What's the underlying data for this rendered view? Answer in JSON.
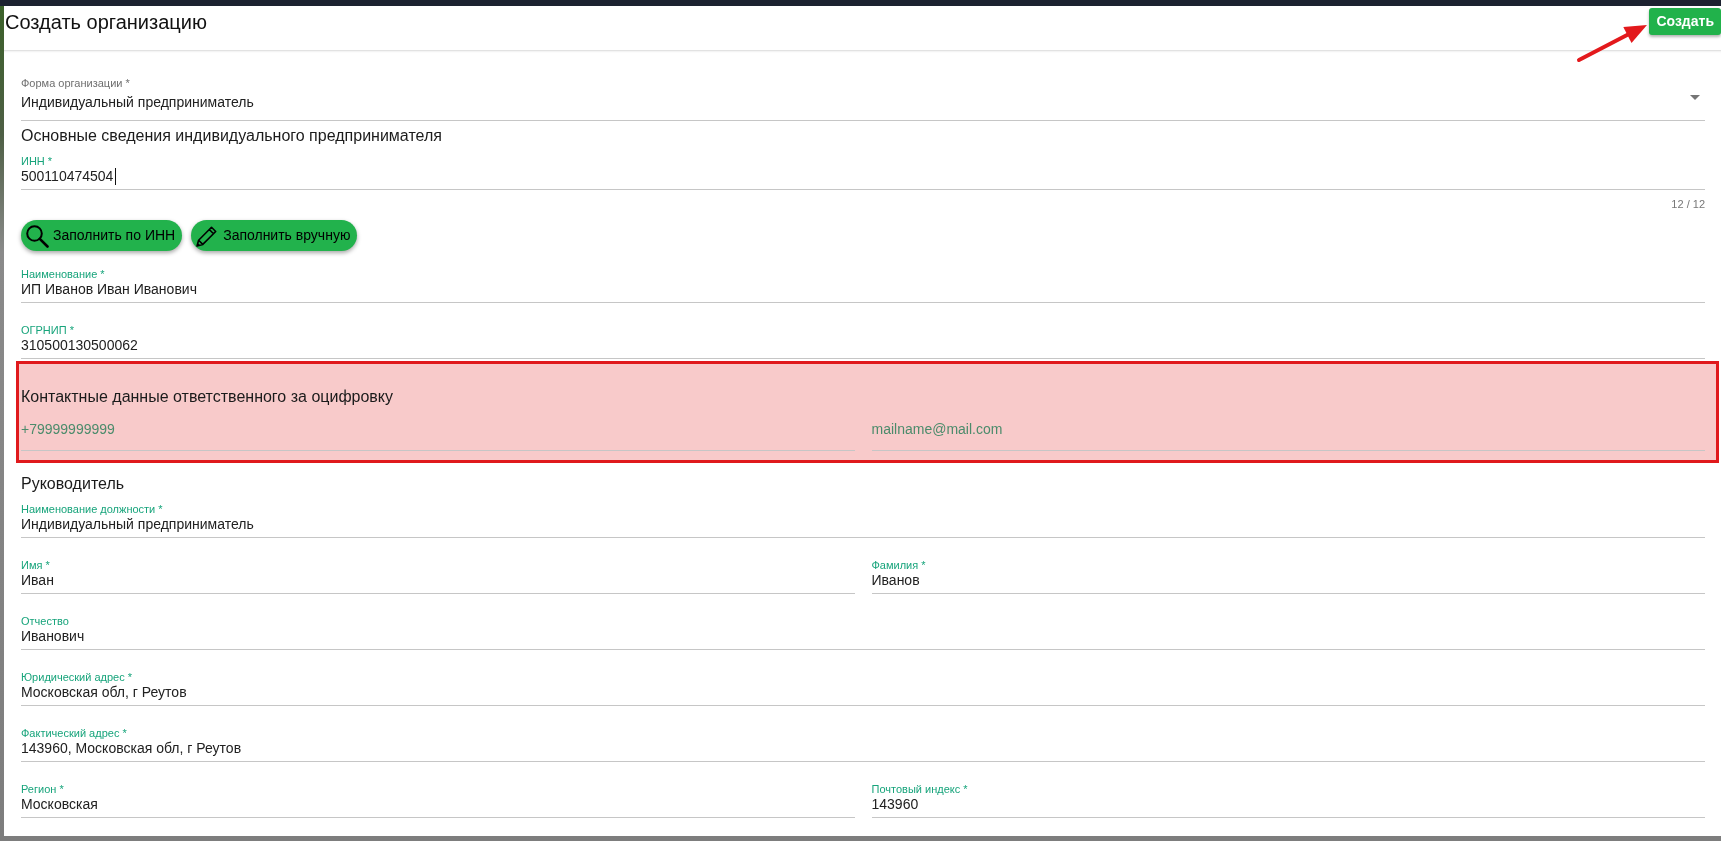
{
  "dialog": {
    "title": "Создать организацию",
    "create_button": {
      "label": "Создать",
      "pointed_at": true
    }
  },
  "organization_form": {
    "label": "Форма организации *",
    "value": "Индивидуальный предприниматель"
  },
  "sections": [
    {
      "title": "Основные сведения индивидуального предпринимателя",
      "highlighted": false,
      "rows": [
        {
          "kind": "fields",
          "fields": [
            {
              "label": "ИНН *",
              "value": "500110474504",
              "focused": true,
              "counter": "12 / 12"
            }
          ]
        },
        {
          "kind": "buttons",
          "buttons": [
            {
              "kind": "lookup",
              "label": "Заполнить по ИНН"
            },
            {
              "kind": "manual",
              "label": "Заполнить вручную"
            }
          ]
        },
        {
          "kind": "fields",
          "fields": [
            {
              "label": "Наименование *",
              "value": "ИП Иванов Иван Иванович",
              "focused": false
            }
          ]
        },
        {
          "kind": "fields",
          "fields": [
            {
              "label": "ОГРНИП *",
              "value": "310500130500062",
              "focused": false
            }
          ]
        }
      ]
    },
    {
      "title": "Контактные данные ответственного за оцифровку",
      "highlighted": true,
      "rows": [
        {
          "kind": "fields",
          "fields": [
            {
              "placeholder": "+79999999999",
              "focused": false
            },
            {
              "placeholder": "mailname@mail.com",
              "focused": false
            }
          ]
        }
      ]
    },
    {
      "title": "Руководитель",
      "highlighted": false,
      "rows": [
        {
          "kind": "fields",
          "fields": [
            {
              "label": "Наименование должности *",
              "value": "Индивидуальный предприниматель",
              "focused": false
            }
          ]
        },
        {
          "kind": "fields",
          "fields": [
            {
              "label": "Имя *",
              "value": "Иван",
              "focused": false
            },
            {
              "label": "Фамилия *",
              "value": "Иванов",
              "focused": false
            }
          ]
        },
        {
          "kind": "fields",
          "fields": [
            {
              "label": "Отчество",
              "value": "Иванович",
              "focused": false
            }
          ]
        },
        {
          "kind": "fields",
          "fields": [
            {
              "label": "Юридический адрес *",
              "value": "Московская обл, г Реутов",
              "focused": false
            }
          ]
        },
        {
          "kind": "fields",
          "fields": [
            {
              "label": "Фактический адрес *",
              "value": "143960, Московская обл, г Реутов",
              "focused": false
            }
          ]
        },
        {
          "kind": "fields",
          "fields": [
            {
              "label": "Регион *",
              "value": "Московская",
              "focused": false
            },
            {
              "label": "Почтовый индекс *",
              "value": "143960",
              "focused": false
            }
          ]
        }
      ]
    }
  ]
}
